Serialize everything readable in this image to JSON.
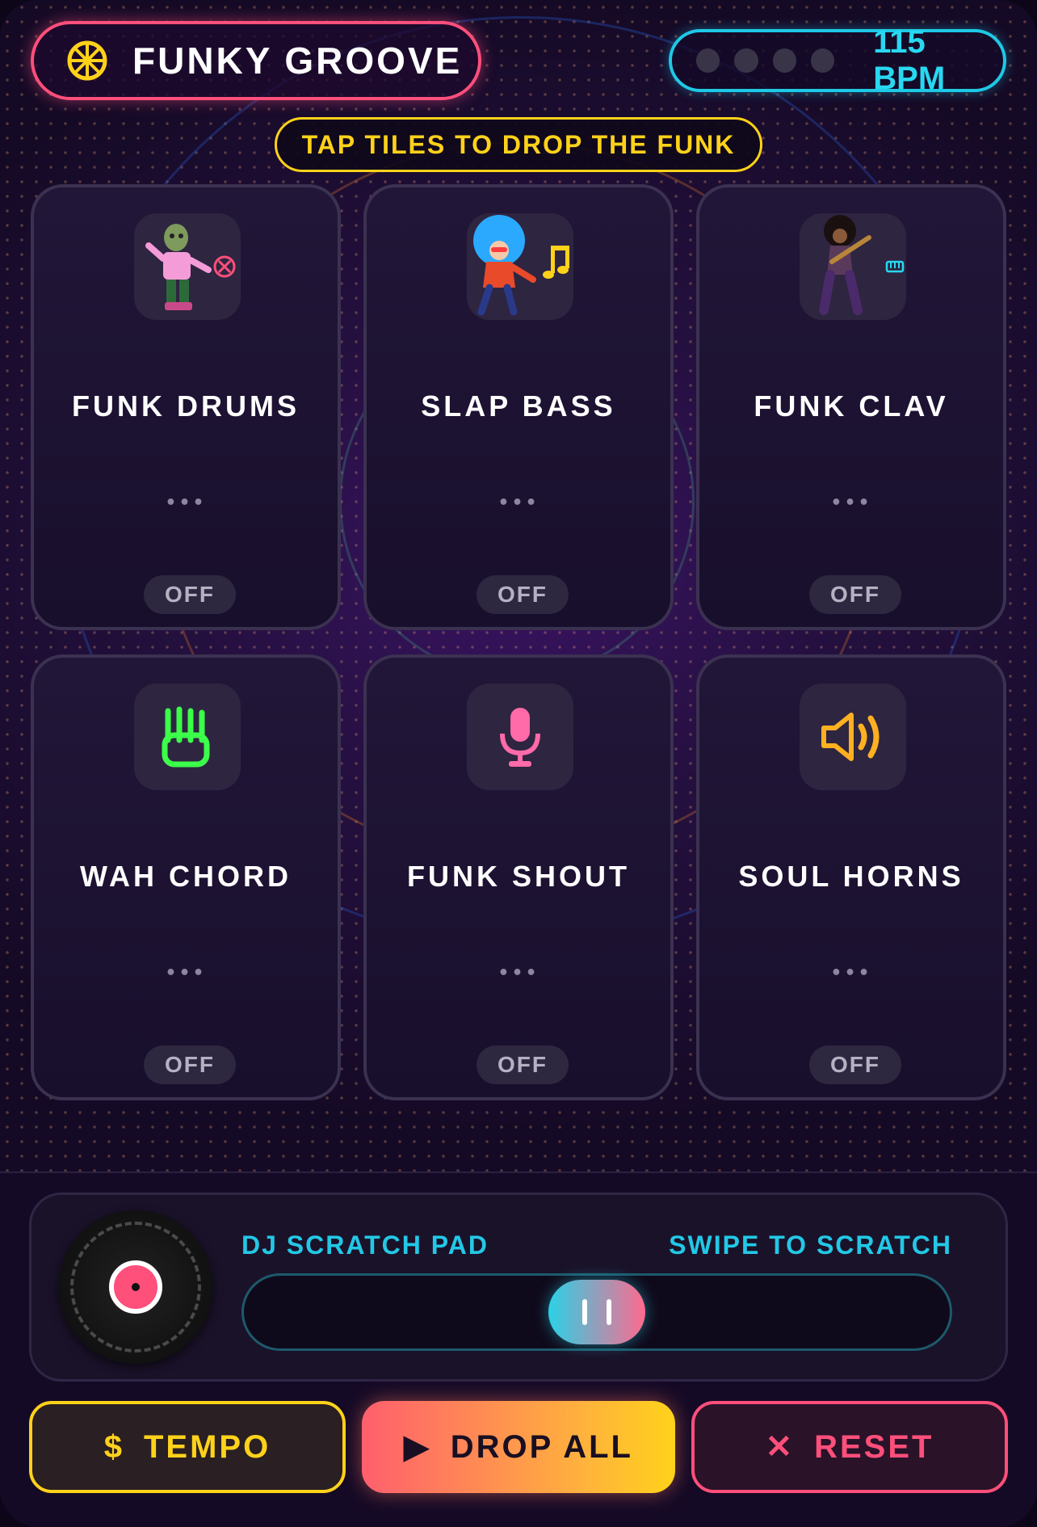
{
  "header": {
    "title": "FUNKY GROOVE",
    "title_icon": "wheel-icon",
    "bpm_label": "115 BPM",
    "beat_dots": 4,
    "hint": "TAP TILES TO DROP THE FUNK"
  },
  "tiles": [
    {
      "name": "FUNK DRUMS",
      "icon": "zombie-dancer-icon",
      "badge_icon": "cancel-circle-icon",
      "dots": "•••",
      "status": "OFF"
    },
    {
      "name": "SLAP BASS",
      "icon": "afro-dancer-icon",
      "badge_icon": "music-note-icon",
      "dots": "•••",
      "status": "OFF"
    },
    {
      "name": "FUNK CLAV",
      "icon": "guitarist-icon",
      "badge_icon": "keyboard-icon",
      "dots": "•••",
      "status": "OFF"
    },
    {
      "name": "WAH CHORD",
      "icon": "guitar-pick-hand-icon",
      "dots": "•••",
      "status": "OFF"
    },
    {
      "name": "FUNK SHOUT",
      "icon": "microphone-icon",
      "dots": "•••",
      "status": "OFF"
    },
    {
      "name": "SOUL HORNS",
      "icon": "speaker-icon",
      "dots": "•••",
      "status": "OFF"
    }
  ],
  "scratch_pad": {
    "title": "DJ SCRATCH PAD",
    "hint": "SWIPE TO SCRATCH",
    "knob_icon": "pause-icon",
    "knob_position": 0.5
  },
  "actions": {
    "tempo": {
      "glyph": "$",
      "label": "TEMPO"
    },
    "drop_all": {
      "glyph": "▶",
      "label": "DROP ALL"
    },
    "reset": {
      "glyph": "✕",
      "label": "RESET"
    }
  },
  "colors": {
    "accent_pink": "#ff4f7b",
    "accent_cyan": "#1ec9e6",
    "accent_yellow": "#ffd21a",
    "tile_bg": "#1c1230"
  }
}
